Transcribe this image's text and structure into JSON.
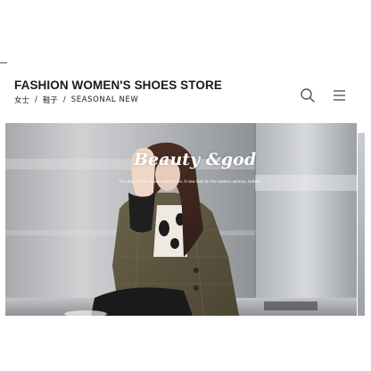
{
  "header": {
    "store_title": "FASHION WOMEN'S SHOES STORE",
    "breadcrumb": [
      "女士",
      "鞋子",
      "SEASONAL NEW"
    ],
    "separator": "/",
    "search_icon": "search-icon",
    "menu_icon": "hamburger-menu-icon"
  },
  "hero": {
    "brand": "Beauty &god",
    "caption": "The story of this season starts here. A new look for the modern woman, fashion and comfort."
  },
  "colors": {
    "text": "#1a1a1a",
    "background": "#ffffff",
    "icon": "#555555"
  }
}
